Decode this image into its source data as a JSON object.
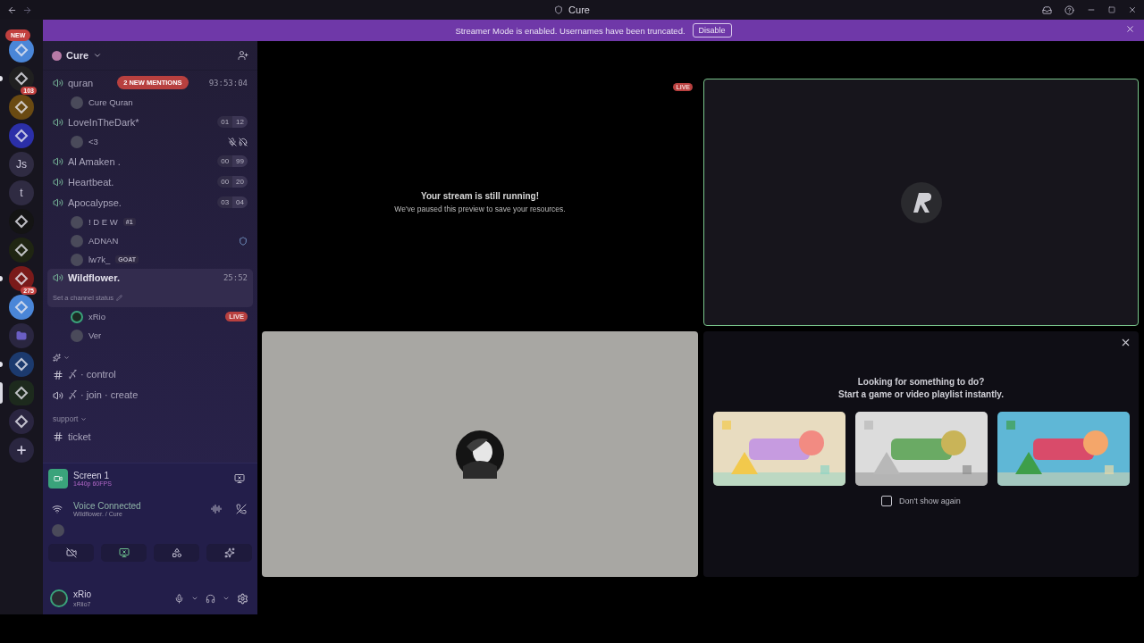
{
  "title_bar": {
    "title": "Cure"
  },
  "banner": {
    "message": "Streamer Mode is enabled. Usernames have been truncated.",
    "button": "Disable"
  },
  "servers": [
    {
      "kind": "logo",
      "color": "#4a86d8",
      "selected": false,
      "unread": false,
      "badge": {
        "kind": "pill",
        "text": "NEW"
      }
    },
    {
      "kind": "logo",
      "color": "#202020",
      "selected": false,
      "unread": true,
      "badge": {
        "kind": "count",
        "text": "103"
      }
    },
    {
      "kind": "logo",
      "color": "#6a4a12",
      "selected": false,
      "unread": false
    },
    {
      "kind": "logo",
      "color": "#2b2fa8",
      "selected": false,
      "unread": false
    },
    {
      "kind": "letters",
      "label": "Js",
      "selected": false,
      "unread": false
    },
    {
      "kind": "letters",
      "label": "t",
      "selected": false,
      "unread": false
    },
    {
      "kind": "logo",
      "color": "#141414",
      "selected": false,
      "unread": false
    },
    {
      "kind": "logo",
      "color": "#1f2512",
      "selected": false,
      "unread": false
    },
    {
      "kind": "logo",
      "color": "#7a1a1a",
      "selected": false,
      "unread": true,
      "badge": {
        "kind": "count",
        "text": "275"
      }
    },
    {
      "kind": "logo",
      "color": "#4a86d8",
      "selected": false,
      "unread": false
    },
    {
      "kind": "folder",
      "selected": false,
      "unread": false
    },
    {
      "kind": "logo",
      "color": "#1c3a6e",
      "selected": false,
      "unread": true
    },
    {
      "kind": "logo",
      "color": "#1d2a1d",
      "selected": true,
      "unread": false
    },
    {
      "kind": "logo",
      "color": "#2a2540",
      "selected": false,
      "unread": false
    },
    {
      "kind": "add",
      "selected": false,
      "unread": false
    }
  ],
  "server_header": {
    "name": "Cure"
  },
  "voice_channels": [
    {
      "name": "quran",
      "selected": false,
      "mention": "2 NEW MENTIONS",
      "timer": "93:53:04",
      "members": [
        {
          "name": "Cure Quran",
          "live": false,
          "muted": false,
          "deafened": false,
          "has_activity": false
        }
      ]
    },
    {
      "name": "LoveInTheDark*",
      "selected": false,
      "counts": [
        "01",
        "12"
      ],
      "members": [
        {
          "name": "<3",
          "live": false,
          "muted": true,
          "deafened": true,
          "has_activity": false
        }
      ]
    },
    {
      "name": "Al Amaken .",
      "selected": false,
      "counts": [
        "00",
        "99"
      ]
    },
    {
      "name": "Heartbeat.",
      "selected": false,
      "counts": [
        "00",
        "20"
      ]
    },
    {
      "name": "Apocalypse.",
      "selected": false,
      "counts": [
        "03",
        "04"
      ],
      "members": [
        {
          "name": "! D E W",
          "tag": "#1",
          "live": false,
          "muted": false,
          "deafened": false,
          "has_activity": false
        },
        {
          "name": "ADNAN",
          "live": false,
          "muted": false,
          "deafened": false,
          "has_activity": true
        },
        {
          "name": "lw7k_",
          "tag": "GOAT",
          "live": false,
          "muted": false,
          "deafened": false,
          "has_activity": false
        }
      ]
    },
    {
      "name": "Wildflower.",
      "selected": true,
      "timer": "25:52",
      "status": "Set a channel status",
      "members": [
        {
          "name": "xRio",
          "live": true,
          "live_label": "LIVE",
          "muted": false,
          "deafened": false,
          "has_activity": false
        },
        {
          "name": "Ver",
          "live": false,
          "muted": false,
          "deafened": false,
          "has_activity": false
        }
      ]
    }
  ],
  "categories": [
    {
      "kind": "icon",
      "expanded": true,
      "channels": [
        {
          "kind": "text",
          "name": "〆 · control"
        },
        {
          "kind": "voice",
          "name": "〆 · join · create"
        }
      ]
    },
    {
      "kind": "text",
      "name": "support",
      "expanded": true,
      "channels": [
        {
          "kind": "text",
          "name": "ticket"
        }
      ]
    }
  ],
  "stream_card": {
    "title": "Screen 1",
    "quality": "1440p 60FPS"
  },
  "voice_status": {
    "title": "Voice Connected",
    "location": "Wildflower. / Cure"
  },
  "user": {
    "name": "xRio",
    "status": "xRiio7",
    "mic_muted": false,
    "deafened": false
  },
  "stream_preview": {
    "title": "Your stream is still running!",
    "subtitle": "We've paused this preview to save your resources.",
    "badge": "LIVE"
  },
  "tiles": [
    {
      "kind": "logo",
      "focused": true
    },
    {
      "kind": "avatar",
      "focused": false
    }
  ],
  "activity_panel": {
    "heading": "Looking for something to do?",
    "subheading": "Start a game or video playlist instantly.",
    "opt_out": {
      "label": "Don't show again",
      "checked": false
    }
  }
}
